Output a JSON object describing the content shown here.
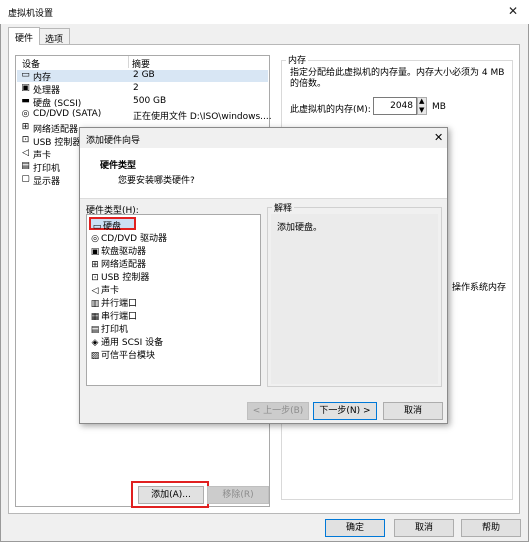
{
  "window": {
    "title": "虚拟机设置",
    "close_glyph": "✕",
    "tabs": [
      "硬件",
      "选项"
    ]
  },
  "device_table": {
    "headers": [
      "设备",
      "摘要"
    ],
    "rows": [
      {
        "icon": "memory-icon",
        "glyph": "▭",
        "name": "内存",
        "value": "2 GB"
      },
      {
        "icon": "processor-icon",
        "glyph": "▣",
        "name": "处理器",
        "value": "2"
      },
      {
        "icon": "hard-disk-icon",
        "glyph": "▬",
        "name": "硬盘 (SCSI)",
        "value": "500 GB"
      },
      {
        "icon": "cd-dvd-icon",
        "glyph": "◎",
        "name": "CD/DVD (SATA)",
        "value": "正在使用文件 D:\\ISO\\windows...."
      },
      {
        "icon": "network-adapter-icon",
        "glyph": "⊞",
        "name": "网络适配器",
        "value": ""
      },
      {
        "icon": "usb-controller-icon",
        "glyph": "⊡",
        "name": "USB 控制器",
        "value": ""
      },
      {
        "icon": "sound-card-icon",
        "glyph": "◁",
        "name": "声卡",
        "value": ""
      },
      {
        "icon": "printer-icon",
        "glyph": "▤",
        "name": "打印机",
        "value": ""
      },
      {
        "icon": "display-icon",
        "glyph": "▢",
        "name": "显示器",
        "value": ""
      }
    ]
  },
  "memory": {
    "group_title": "内存",
    "description": "指定分配给此虚拟机的内存量。内存大小必须为 4 MB 的倍数。",
    "label": "此虚拟机的内存(M):",
    "value": "2048",
    "unit": "MB",
    "partial_text": "操作系统内存"
  },
  "buttons": {
    "add": "添加(A)...",
    "remove": "移除(R)",
    "ok": "确定",
    "cancel": "取消",
    "help": "帮助"
  },
  "wizard": {
    "title": "添加硬件向导",
    "close_glyph": "✕",
    "heading": "硬件类型",
    "subheading": "您要安装哪类硬件?",
    "list_label": "硬件类型(H):",
    "items": [
      {
        "icon": "hard-disk-icon",
        "glyph": "▭",
        "label": "硬盘"
      },
      {
        "icon": "cd-dvd-icon",
        "glyph": "◎",
        "label": "CD/DVD 驱动器"
      },
      {
        "icon": "floppy-icon",
        "glyph": "▣",
        "label": "软盘驱动器"
      },
      {
        "icon": "network-adapter-icon",
        "glyph": "⊞",
        "label": "网络适配器"
      },
      {
        "icon": "usb-controller-icon",
        "glyph": "⊡",
        "label": "USB 控制器"
      },
      {
        "icon": "sound-card-icon",
        "glyph": "◁",
        "label": "声卡"
      },
      {
        "icon": "parallel-port-icon",
        "glyph": "▥",
        "label": "并行端口"
      },
      {
        "icon": "serial-port-icon",
        "glyph": "▦",
        "label": "串行端口"
      },
      {
        "icon": "printer-icon",
        "glyph": "▤",
        "label": "打印机"
      },
      {
        "icon": "generic-scsi-icon",
        "glyph": "◈",
        "label": "通用 SCSI 设备"
      },
      {
        "icon": "tpm-icon",
        "glyph": "▨",
        "label": "可信平台模块"
      }
    ],
    "explain_title": "解释",
    "explain_text": "添加硬盘。",
    "back": "< 上一步(B)",
    "next": "下一步(N) >",
    "cancel": "取消"
  },
  "colors": {
    "highlight": "#e02020",
    "selection": "#d8e6f4",
    "accent": "#0078d7"
  }
}
